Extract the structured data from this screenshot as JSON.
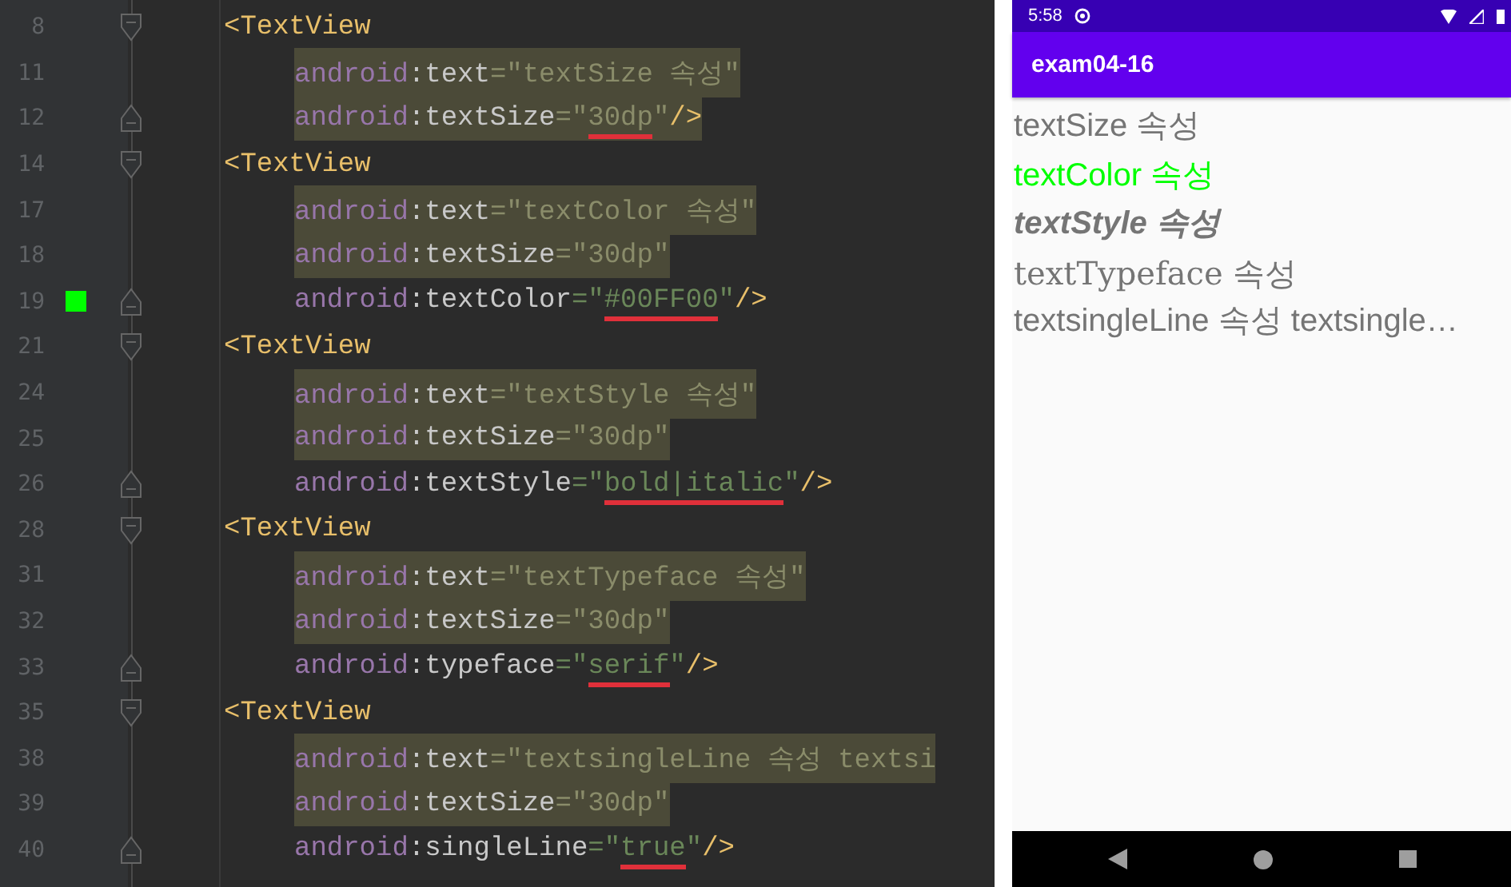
{
  "editor": {
    "lines": [
      {
        "number": "8",
        "fold_start": true,
        "highlighted": false,
        "tokens": [
          {
            "kind": "tag",
            "text": "<TextView"
          }
        ]
      },
      {
        "number": "11",
        "highlighted": true,
        "tokens": [
          {
            "kind": "ns",
            "text": "android"
          },
          {
            "kind": "name",
            "text": ":text"
          },
          {
            "kind": "string",
            "text": "=\"textSize 속성\""
          }
        ]
      },
      {
        "number": "12",
        "fold_end": true,
        "highlighted": true,
        "tokens": [
          {
            "kind": "ns",
            "text": "android"
          },
          {
            "kind": "name",
            "text": ":textSize"
          },
          {
            "kind": "string",
            "text": "=\""
          },
          {
            "kind": "string",
            "text": "30dp",
            "underlined": true
          },
          {
            "kind": "string",
            "text": "\""
          },
          {
            "kind": "tag",
            "text": "/>"
          }
        ]
      },
      {
        "number": "14",
        "fold_start": true,
        "highlighted": false,
        "tokens": [
          {
            "kind": "tag",
            "text": "<TextView"
          }
        ]
      },
      {
        "number": "17",
        "highlighted": true,
        "tokens": [
          {
            "kind": "ns",
            "text": "android"
          },
          {
            "kind": "name",
            "text": ":text"
          },
          {
            "kind": "string",
            "text": "=\"textColor 속성\""
          }
        ]
      },
      {
        "number": "18",
        "highlighted": true,
        "tokens": [
          {
            "kind": "ns",
            "text": "android"
          },
          {
            "kind": "name",
            "text": ":textSize"
          },
          {
            "kind": "string",
            "text": "=\"30dp\""
          }
        ]
      },
      {
        "number": "19",
        "fold_end": true,
        "color": "#00ff00",
        "highlighted": false,
        "tokens": [
          {
            "kind": "ns",
            "text": "android"
          },
          {
            "kind": "name",
            "text": ":textColor"
          },
          {
            "kind": "string",
            "text": "=\""
          },
          {
            "kind": "string",
            "text": "#00FF00",
            "underlined": true
          },
          {
            "kind": "string",
            "text": "\""
          },
          {
            "kind": "tag",
            "text": "/>"
          }
        ]
      },
      {
        "number": "21",
        "fold_start": true,
        "highlighted": false,
        "tokens": [
          {
            "kind": "tag",
            "text": "<TextView"
          }
        ]
      },
      {
        "number": "24",
        "highlighted": true,
        "tokens": [
          {
            "kind": "ns",
            "text": "android"
          },
          {
            "kind": "name",
            "text": ":text"
          },
          {
            "kind": "string",
            "text": "=\"textStyle 속성\""
          }
        ]
      },
      {
        "number": "25",
        "highlighted": true,
        "tokens": [
          {
            "kind": "ns",
            "text": "android"
          },
          {
            "kind": "name",
            "text": ":textSize"
          },
          {
            "kind": "string",
            "text": "=\"30dp\""
          }
        ]
      },
      {
        "number": "26",
        "fold_end": true,
        "highlighted": false,
        "tokens": [
          {
            "kind": "ns",
            "text": "android"
          },
          {
            "kind": "name",
            "text": ":textStyle"
          },
          {
            "kind": "string",
            "text": "=\""
          },
          {
            "kind": "string",
            "text": "bold|italic",
            "underlined": true
          },
          {
            "kind": "string",
            "text": "\""
          },
          {
            "kind": "tag",
            "text": "/>"
          }
        ]
      },
      {
        "number": "28",
        "fold_start": true,
        "highlighted": false,
        "tokens": [
          {
            "kind": "tag",
            "text": "<TextView"
          }
        ]
      },
      {
        "number": "31",
        "highlighted": true,
        "tokens": [
          {
            "kind": "ns",
            "text": "android"
          },
          {
            "kind": "name",
            "text": ":text"
          },
          {
            "kind": "string",
            "text": "=\"textTypeface 속성\""
          }
        ]
      },
      {
        "number": "32",
        "highlighted": true,
        "tokens": [
          {
            "kind": "ns",
            "text": "android"
          },
          {
            "kind": "name",
            "text": ":textSize"
          },
          {
            "kind": "string",
            "text": "=\"30dp\""
          }
        ]
      },
      {
        "number": "33",
        "fold_end": true,
        "highlighted": false,
        "tokens": [
          {
            "kind": "ns",
            "text": "android"
          },
          {
            "kind": "name",
            "text": ":typeface"
          },
          {
            "kind": "string",
            "text": "=\""
          },
          {
            "kind": "string",
            "text": "serif",
            "underlined": true
          },
          {
            "kind": "string",
            "text": "\""
          },
          {
            "kind": "tag",
            "text": "/>"
          }
        ]
      },
      {
        "number": "35",
        "fold_start": true,
        "highlighted": false,
        "tokens": [
          {
            "kind": "tag",
            "text": "<TextView"
          }
        ]
      },
      {
        "number": "38",
        "highlighted": true,
        "tokens": [
          {
            "kind": "ns",
            "text": "android"
          },
          {
            "kind": "name",
            "text": ":text"
          },
          {
            "kind": "string",
            "text": "=\"textsingleLine 속성 textsi"
          }
        ]
      },
      {
        "number": "39",
        "highlighted": true,
        "tokens": [
          {
            "kind": "ns",
            "text": "android"
          },
          {
            "kind": "name",
            "text": ":textSize"
          },
          {
            "kind": "string",
            "text": "=\"30dp\""
          }
        ]
      },
      {
        "number": "40",
        "fold_end": true,
        "highlighted": false,
        "tokens": [
          {
            "kind": "ns",
            "text": "android"
          },
          {
            "kind": "name",
            "text": ":singleLine"
          },
          {
            "kind": "string",
            "text": "=\""
          },
          {
            "kind": "string",
            "text": "true",
            "underlined": true
          },
          {
            "kind": "string",
            "text": "\""
          },
          {
            "kind": "tag",
            "text": "/>"
          }
        ]
      }
    ]
  },
  "phone": {
    "status_bar": {
      "time": "5:58"
    },
    "app_bar": {
      "title": "exam04-16"
    },
    "texts": [
      {
        "text": "textSize 속성"
      },
      {
        "text": "textColor 속성",
        "color": "#00ff00"
      },
      {
        "text": "textStyle 속성",
        "bold": true,
        "italic": true
      },
      {
        "text": "textTypeface 속성",
        "serif": true
      },
      {
        "text": "textsingleLine 속성 textsingle…"
      }
    ]
  }
}
